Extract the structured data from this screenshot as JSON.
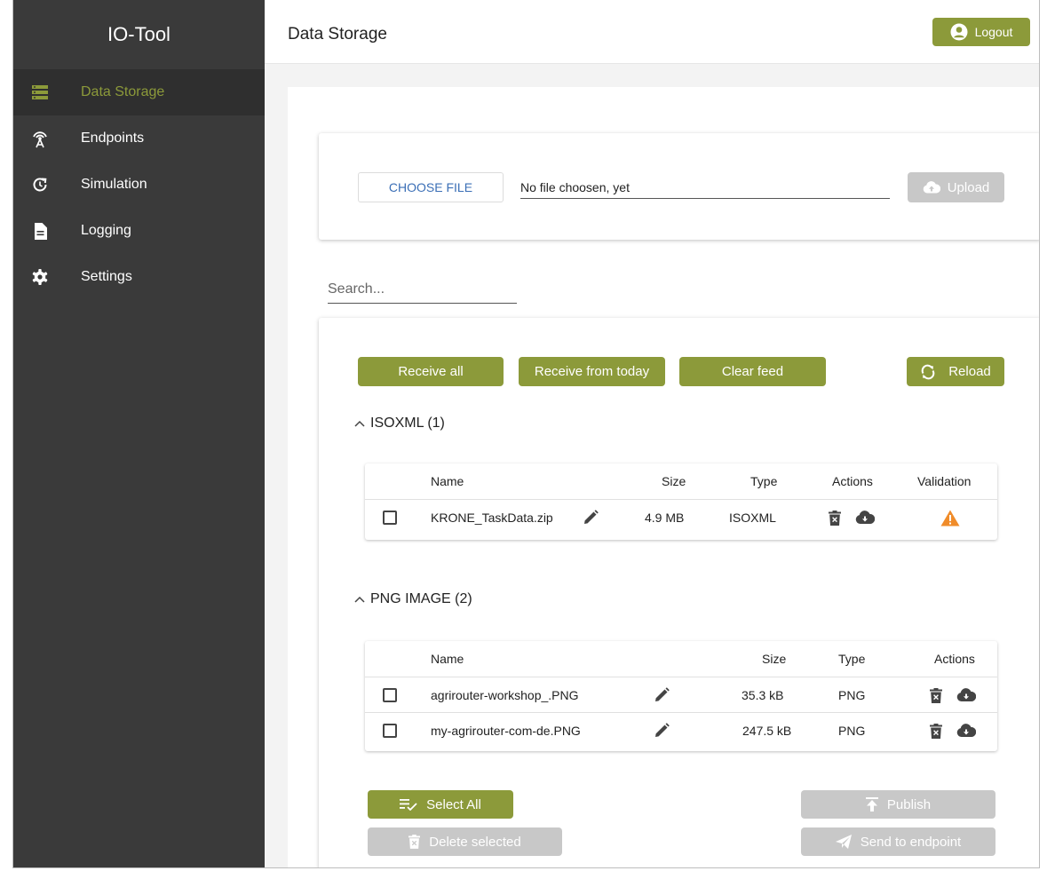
{
  "app": {
    "title": "IO-Tool"
  },
  "sidebar": {
    "items": [
      {
        "label": "Data Storage",
        "icon": "storage-icon",
        "active": true
      },
      {
        "label": "Endpoints",
        "icon": "antenna-icon"
      },
      {
        "label": "Simulation",
        "icon": "refresh-clock-icon"
      },
      {
        "label": "Logging",
        "icon": "document-icon"
      },
      {
        "label": "Settings",
        "icon": "gear-icon"
      }
    ]
  },
  "header": {
    "title": "Data Storage",
    "logout_label": "Logout"
  },
  "upload": {
    "choose_label": "CHOOSE FILE",
    "file_name": "No file choosen, yet",
    "upload_label": "Upload"
  },
  "search": {
    "placeholder": "Search..."
  },
  "feed": {
    "receive_all_label": "Receive all",
    "receive_today_label": "Receive from today",
    "clear_label": "Clear feed",
    "reload_label": "Reload"
  },
  "groups": [
    {
      "title": "ISOXML (1)",
      "columns": [
        "Name",
        "Size",
        "Type",
        "Actions",
        "Validation"
      ],
      "rows": [
        {
          "name": "KRONE_TaskData.zip",
          "size": "4.9 MB",
          "type": "ISOXML"
        }
      ]
    },
    {
      "title": "PNG IMAGE (2)",
      "columns": [
        "Name",
        "Size",
        "Type",
        "Actions"
      ],
      "rows": [
        {
          "name": "agrirouter-workshop_.PNG",
          "size": "35.3 kB",
          "type": "PNG"
        },
        {
          "name": "my-agrirouter-com-de.PNG",
          "size": "247.5 kB",
          "type": "PNG"
        }
      ]
    }
  ],
  "bottom": {
    "select_all_label": "Select All",
    "delete_label": "Delete selected",
    "publish_label": "Publish",
    "send_label": "Send to endpoint"
  },
  "colors": {
    "accent": "#8c9a3a",
    "sidebar_bg": "#3a3a3a",
    "disabled": "#c8c8c8",
    "warning": "#f08c2a",
    "link": "#3b6fb6"
  }
}
